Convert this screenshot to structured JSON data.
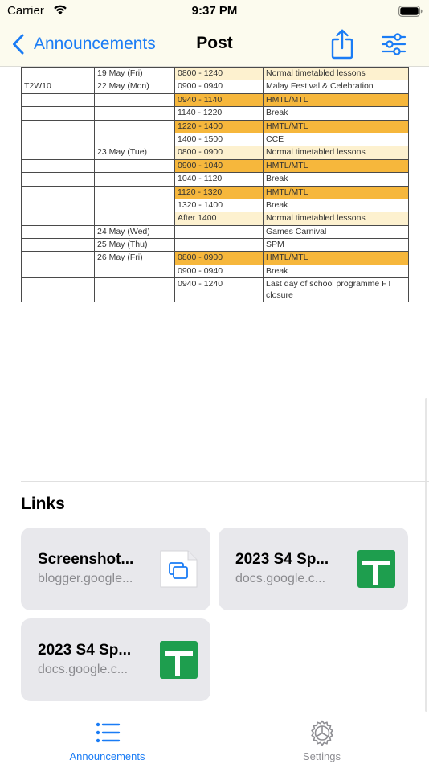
{
  "status_bar": {
    "carrier": "Carrier",
    "time": "9:37 PM"
  },
  "nav": {
    "back_label": "Announcements",
    "title": "Post",
    "accent_color": "#1a7cf5"
  },
  "schedule": {
    "rows": [
      {
        "week": "",
        "date": "19 May (Fri)",
        "time": "0800 - 1240",
        "activity": "Normal timetabled lessons",
        "style": "light"
      },
      {
        "week": "T2W10",
        "date": "22 May (Mon)",
        "time": "0900 - 0940",
        "activity": "Malay Festival & Celebration",
        "style": "none"
      },
      {
        "week": "",
        "date": "",
        "time": "0940 - 1140",
        "activity": "HMTL/MTL",
        "style": "orange"
      },
      {
        "week": "",
        "date": "",
        "time": "1140 - 1220",
        "activity": "Break",
        "style": "none"
      },
      {
        "week": "",
        "date": "",
        "time": "1220 - 1400",
        "activity": "HMTL/MTL",
        "style": "orange"
      },
      {
        "week": "",
        "date": "",
        "time": "1400 - 1500",
        "activity": "CCE",
        "style": "none"
      },
      {
        "week": "",
        "date": "23 May (Tue)",
        "time": "0800 - 0900",
        "activity": "Normal timetabled lessons",
        "style": "light"
      },
      {
        "week": "",
        "date": "",
        "time": "0900 - 1040",
        "activity": "HMTL/MTL",
        "style": "orange"
      },
      {
        "week": "",
        "date": "",
        "time": "1040 - 1120",
        "activity": "Break",
        "style": "none"
      },
      {
        "week": "",
        "date": "",
        "time": "1120 - 1320",
        "activity": "HMTL/MTL",
        "style": "orange"
      },
      {
        "week": "",
        "date": "",
        "time": "1320 - 1400",
        "activity": "Break",
        "style": "none"
      },
      {
        "week": "",
        "date": "",
        "time": "After 1400",
        "activity": "Normal timetabled lessons",
        "style": "light"
      },
      {
        "week": "",
        "date": "24 May (Wed)",
        "time": "",
        "activity": "Games Carnival",
        "style": "none"
      },
      {
        "week": "",
        "date": "25 May (Thu)",
        "time": "",
        "activity": "SPM",
        "style": "none"
      },
      {
        "week": "",
        "date": "26 May (Fri)",
        "time": "0800 - 0900",
        "activity": "HMTL/MTL",
        "style": "orange"
      },
      {
        "week": "",
        "date": "",
        "time": "0900 - 0940",
        "activity": "Break",
        "style": "none"
      },
      {
        "week": "",
        "date": "",
        "time": "0940 - 1240",
        "activity": "Last day of school programme FT closure",
        "style": "none"
      }
    ]
  },
  "links": {
    "heading": "Links",
    "items": [
      {
        "title": "Screenshot...",
        "domain": "blogger.google...",
        "icon": "document-copy-icon"
      },
      {
        "title": "2023 S4 Sp...",
        "domain": "docs.google.c...",
        "icon": "google-sheets-icon"
      },
      {
        "title": "2023 S4 Sp...",
        "domain": "docs.google.c...",
        "icon": "google-sheets-icon"
      }
    ]
  },
  "tabs": [
    {
      "label": "Announcements",
      "icon": "list-icon",
      "active": true
    },
    {
      "label": "Settings",
      "icon": "gear-icon",
      "active": false
    }
  ]
}
